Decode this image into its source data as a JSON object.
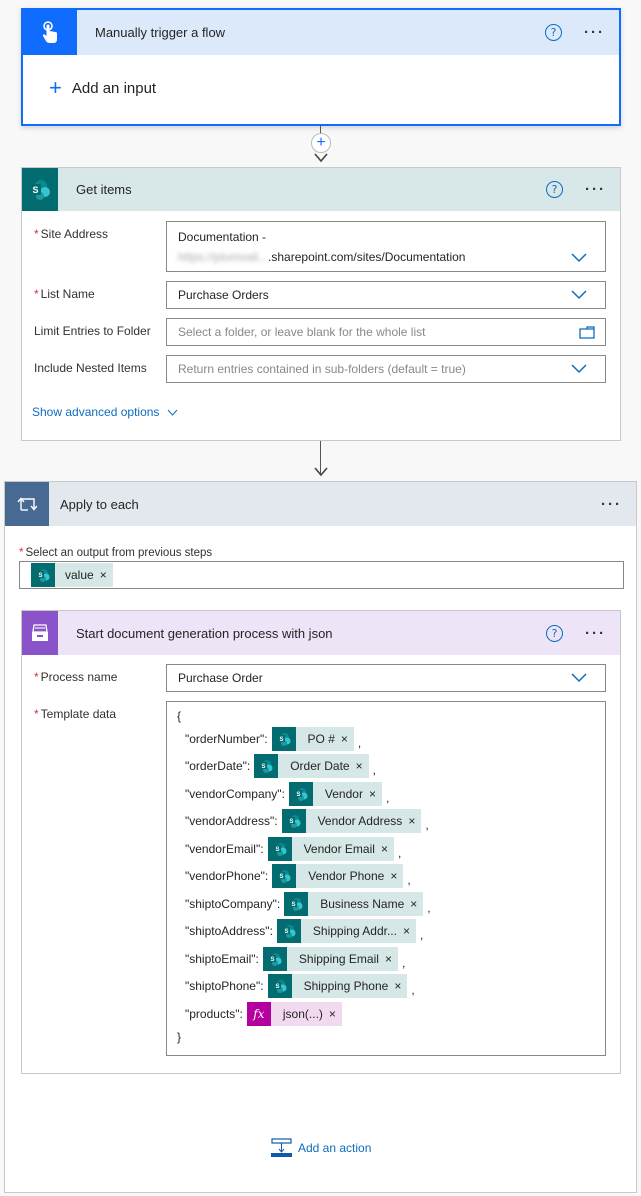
{
  "trigger": {
    "title": "Manually trigger a flow",
    "add_input_label": "Add an input",
    "icon": "touch-hand-icon",
    "color": "#0f6cfd"
  },
  "get_items": {
    "title": "Get items",
    "icon": "sharepoint-icon",
    "color": "#036c70",
    "fields": {
      "site_address": {
        "label": "Site Address",
        "required": true,
        "value_line1": "Documentation -",
        "value_line2_blurred": "https://plumsail...",
        "value_line2": ".sharepoint.com/sites/Documentation"
      },
      "list_name": {
        "label": "List Name",
        "required": true,
        "value": "Purchase Orders"
      },
      "limit_folder": {
        "label": "Limit Entries to Folder",
        "placeholder": "Select a folder, or leave blank for the whole list"
      },
      "nested": {
        "label": "Include Nested Items",
        "placeholder": "Return entries contained in sub-folders (default = true)"
      }
    },
    "advanced_link": "Show advanced options"
  },
  "apply_each": {
    "title": "Apply to each",
    "icon": "loop-icon",
    "color": "#486991",
    "select_label": "Select an output from previous steps",
    "token": "value"
  },
  "docgen": {
    "title": "Start document generation process with json",
    "icon": "file-cabinet-icon",
    "color": "#8a53c9",
    "process_label": "Process name",
    "process_value": "Purchase Order",
    "template_label": "Template data",
    "open_brace": "{",
    "close_brace": "}",
    "template_lines": [
      {
        "key": "\"orderNumber\":",
        "token": "PO #",
        "type": "sharepoint",
        "comma": ","
      },
      {
        "key": "\"orderDate\":",
        "token": "Order Date",
        "type": "sharepoint",
        "comma": ","
      },
      {
        "key": "\"vendorCompany\":",
        "token": "Vendor",
        "type": "sharepoint",
        "comma": ","
      },
      {
        "key": "\"vendorAddress\":",
        "token": "Vendor Address",
        "type": "sharepoint",
        "comma": ","
      },
      {
        "key": "\"vendorEmail\":",
        "token": "Vendor Email",
        "type": "sharepoint",
        "comma": ","
      },
      {
        "key": "\"vendorPhone\":",
        "token": "Vendor Phone",
        "type": "sharepoint",
        "comma": ","
      },
      {
        "key": "\"shiptoCompany\":",
        "token": "Business Name",
        "type": "sharepoint",
        "comma": ","
      },
      {
        "key": "\"shiptoAddress\":",
        "token": "Shipping Addr...",
        "type": "sharepoint",
        "comma": ","
      },
      {
        "key": "\"shiptoEmail\":",
        "token": "Shipping Email",
        "type": "sharepoint",
        "comma": ","
      },
      {
        "key": "\"shiptoPhone\":",
        "token": "Shipping Phone",
        "type": "sharepoint",
        "comma": ","
      },
      {
        "key": "\"products\":",
        "token": "json(...)",
        "type": "expression",
        "comma": ""
      }
    ]
  },
  "add_action_label": "Add an action",
  "common": {
    "required_marker": "*",
    "remove_glyph": "×",
    "fx_glyph": "fx"
  }
}
